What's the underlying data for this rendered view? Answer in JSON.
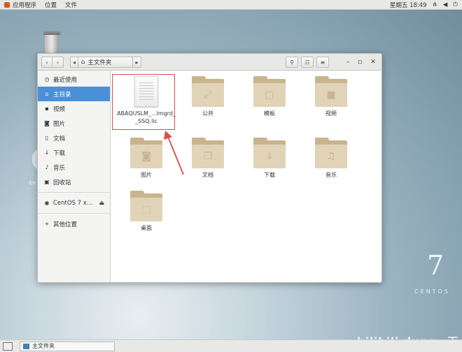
{
  "topbar": {
    "apps_label": "应用程序",
    "places_label": "位置",
    "file_label": "文件",
    "clock": "星期五 18:49"
  },
  "desktop": {
    "partial_label": "Ce",
    "centos_number": "7",
    "centos_word": "CENTOS",
    "watermark": "bilibili dung一下"
  },
  "window": {
    "path_label": "主文件夹"
  },
  "sidebar": {
    "items": [
      {
        "label": "最近使用",
        "icon": "clock-icon"
      },
      {
        "label": "主目录",
        "icon": "home-icon"
      },
      {
        "label": "视频",
        "icon": "video-icon"
      },
      {
        "label": "图片",
        "icon": "camera-icon"
      },
      {
        "label": "文档",
        "icon": "document-icon"
      },
      {
        "label": "下载",
        "icon": "download-icon"
      },
      {
        "label": "音乐",
        "icon": "music-icon"
      },
      {
        "label": "回收站",
        "icon": "trash-icon"
      },
      {
        "label": "CentOS 7 x…",
        "icon": "disc-icon"
      },
      {
        "label": "其他位置",
        "icon": "plus-icon"
      }
    ]
  },
  "files": {
    "license_line1": "ABAQUSLM_...lmgrd_",
    "license_line2": "_SSQ.lic",
    "public": "公共",
    "templates": "模板",
    "videos": "视频",
    "pictures": "图片",
    "documents": "文档",
    "downloads": "下载",
    "music": "音乐",
    "desktop": "桌面"
  },
  "taskbar": {
    "item_label": "主文件夹"
  },
  "colors": {
    "accent": "#4a90d9",
    "highlight_border": "#e24a4a",
    "folder": "#e0d3b8"
  }
}
